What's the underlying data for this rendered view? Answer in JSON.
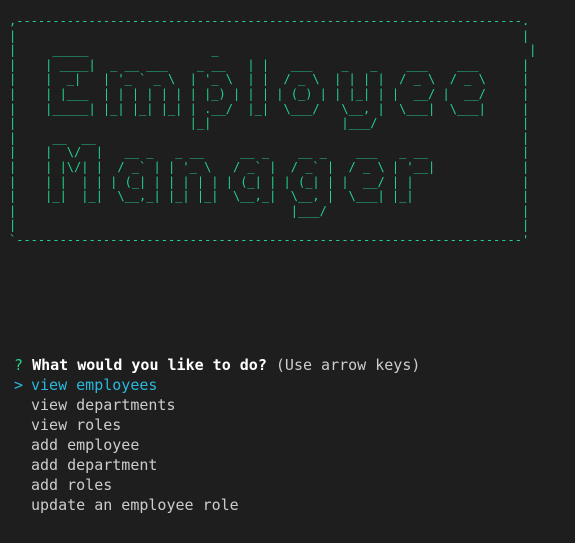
{
  "banner": {
    "art": ",----------------------------------------------------------------------.\n|                                                                      |\n|     _____                 _                                           |\n|    | ____|  _ __ ___    _ __   | |   ___    _   _    ___    ___      |\n|    |  _|   | '_ ` _ \\  | '_ \\  | |  / _ \\  | | | |  / _ \\  / _ \\     |\n|    | |___  | | | | | | | |_) | | | | (_) | | |_| | |  __/ |  __/     |\n|    |_____| |_| |_| |_| | .__/  |_|  \\___/   \\__, |  \\___|  \\___|     |\n|                        |_|                  |___/                    |\n|     __  __                                                           |\n|    |  \\/  |   __ _   _ __     __ _    __ _    ___   _ __             |\n|    | |\\/| |  / _` | | '_ \\   / _` |  / _` |  / _ \\ | '__|            |\n|    | |  | | | (_| | | | | | | (_| | | (_| | |  __/ | |               |\n|    |_|  |_|  \\__,_| |_| |_|  \\__,_|  \\__, |  \\___| |_|               |\n|                                      |___/                           |\n|                                                                      |\n`----------------------------------------------------------------------'"
  },
  "prompt": {
    "qmark": "?",
    "question": "What would you like to do?",
    "hint": "(Use arrow keys)"
  },
  "pointer": ">",
  "choices": [
    {
      "label": "view employees",
      "selected": true
    },
    {
      "label": "view departments",
      "selected": false
    },
    {
      "label": "view roles",
      "selected": false
    },
    {
      "label": "add employee",
      "selected": false
    },
    {
      "label": "add department",
      "selected": false
    },
    {
      "label": "add roles",
      "selected": false
    },
    {
      "label": "update an employee role",
      "selected": false
    }
  ],
  "colors": {
    "background": "#1e1e1e",
    "banner": "#23d18b",
    "selected": "#29b8db",
    "text": "#cccccc",
    "question": "#ffffff"
  }
}
